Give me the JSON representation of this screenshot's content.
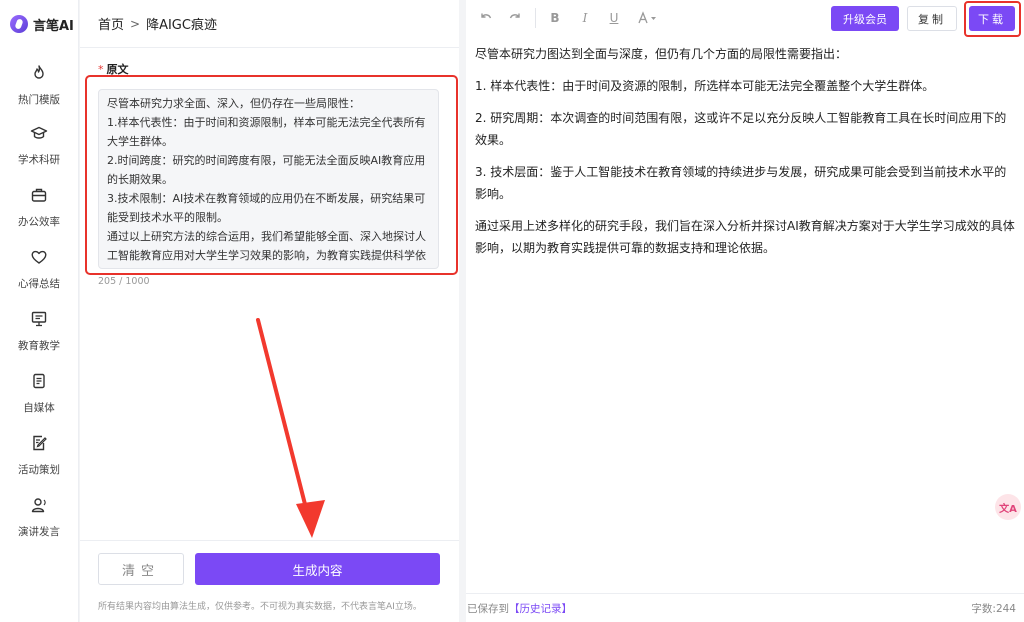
{
  "app": {
    "logo_text": "言笔AI"
  },
  "sidebar": {
    "items": [
      {
        "label": "热门模版",
        "icon": "flame-icon"
      },
      {
        "label": "学术科研",
        "icon": "graduation-cap-icon"
      },
      {
        "label": "办公效率",
        "icon": "briefcase-icon"
      },
      {
        "label": "心得总结",
        "icon": "heart-icon"
      },
      {
        "label": "教育教学",
        "icon": "presentation-icon"
      },
      {
        "label": "自媒体",
        "icon": "document-icon"
      },
      {
        "label": "活动策划",
        "icon": "edit-note-icon"
      },
      {
        "label": "演讲发言",
        "icon": "speaker-user-icon"
      }
    ]
  },
  "header": {
    "breadcrumb_home": "首页",
    "breadcrumb_sep": ">",
    "breadcrumb_current": "降AIGC痕迹"
  },
  "input": {
    "label": "原文",
    "required_mark": "*",
    "paragraphs": [
      "尽管本研究力求全面、深入，但仍存在一些局限性：",
      "1.样本代表性：由于时间和资源限制，样本可能无法完全代表所有大学生群体。",
      "2.时间跨度：研究的时间跨度有限，可能无法全面反映AI教育应用的长期效果。",
      "3.技术限制：AI技术在教育领域的应用仍在不断发展，研究结果可能受到技术水平的限制。",
      "通过以上研究方法的综合运用，我们希望能够全面、深入地探讨人工智能教育应用对大学生学习效果的影响，为教育实践提供科学依据和参考。"
    ],
    "counter": "205 / 1000"
  },
  "actions": {
    "clear_label": "清空",
    "generate_label": "生成内容"
  },
  "disclaimer": "所有结果内容均由算法生成，仅供参考。不可视为真实数据，不代表言笔AI立场。",
  "toolbar": {
    "upgrade_label": "升级会员",
    "copy_label": "复制",
    "download_label": "下载"
  },
  "output": {
    "paragraphs": [
      "尽管本研究力图达到全面与深度，但仍有几个方面的局限性需要指出：",
      "1. 样本代表性：由于时间及资源的限制，所选样本可能无法完全覆盖整个大学生群体。",
      "2. 研究周期：本次调查的时间范围有限，这或许不足以充分反映人工智能教育工具在长时间应用下的效果。",
      "3. 技术层面：鉴于人工智能技术在教育领域的持续进步与发展，研究成果可能会受到当前技术水平的影响。",
      "通过采用上述多样化的研究手段，我们旨在深入分析并探讨AI教育解决方案对于大学生学习成效的具体影响，以期为教育实践提供可靠的数据支持和理论依据。"
    ]
  },
  "footer": {
    "saved_prefix": "已保存到",
    "history_link": "【历史记录】",
    "word_count": "字数:244"
  },
  "float_badge": "文A",
  "colors": {
    "accent": "#7b49f5",
    "highlight": "#e8322b"
  }
}
